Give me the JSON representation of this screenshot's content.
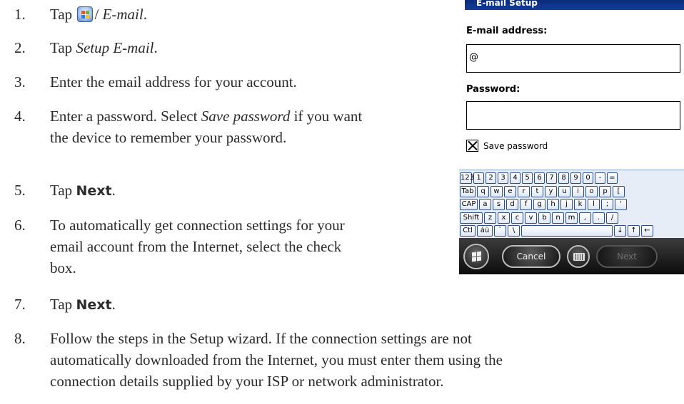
{
  "steps": [
    {
      "num": "1.",
      "prefix": "Tap ",
      "suffix": "/ ",
      "em": "E-mail",
      "end": "."
    },
    {
      "num": "2.",
      "prefix": "Tap ",
      "em": "Setup E-mail",
      "end": "."
    },
    {
      "num": "3.",
      "text": "Enter the email address for your account."
    },
    {
      "num": "4.",
      "prefix": "Enter a password. Select ",
      "em": "Save password",
      "suffix": " if you want",
      "line2": "the device to remember your password."
    },
    {
      "num": "5.",
      "prefix": "Tap ",
      "bold": "Next",
      "end": "."
    },
    {
      "num": "6.",
      "line1": "To automatically get connection settings for your",
      "line2": "email account from the Internet, select the check",
      "line3": "box."
    },
    {
      "num": "7.",
      "prefix": "Tap ",
      "bold": "Next",
      "end": "."
    },
    {
      "num": "8.",
      "line1": "Follow the steps in the Setup wizard. If the connection settings are not",
      "line2": "automatically downloaded from the Internet, you must enter them using the",
      "line3": "connection details supplied by your ISP or network administrator."
    }
  ],
  "phone": {
    "title": "E-mail Setup",
    "email_label": "E-mail address:",
    "email_value": "@",
    "password_label": "Password:",
    "password_value": "",
    "save_password_label": "Save password",
    "save_password_checked": true,
    "keyboard": {
      "row1": [
        "123",
        "1",
        "2",
        "3",
        "4",
        "5",
        "6",
        "7",
        "8",
        "9",
        "0",
        "-",
        "="
      ],
      "row2": [
        "Tab",
        "q",
        "w",
        "e",
        "r",
        "t",
        "y",
        "u",
        "i",
        "o",
        "p",
        "["
      ],
      "row3": [
        "CAP",
        "a",
        "s",
        "d",
        "f",
        "g",
        "h",
        "j",
        "k",
        "l",
        ";",
        "'"
      ],
      "row4": [
        "Shift",
        "z",
        "x",
        "c",
        "v",
        "b",
        "n",
        "m",
        ",",
        ".",
        "/"
      ],
      "row5": [
        "Ctl",
        "áü",
        "`",
        "\\",
        "",
        "↓",
        "↑",
        "←"
      ]
    },
    "softkeys": {
      "cancel": "Cancel",
      "next": "Next"
    }
  },
  "colors": {
    "title_bar": "#0b2a7a",
    "softbar": "#1a1a1a"
  }
}
